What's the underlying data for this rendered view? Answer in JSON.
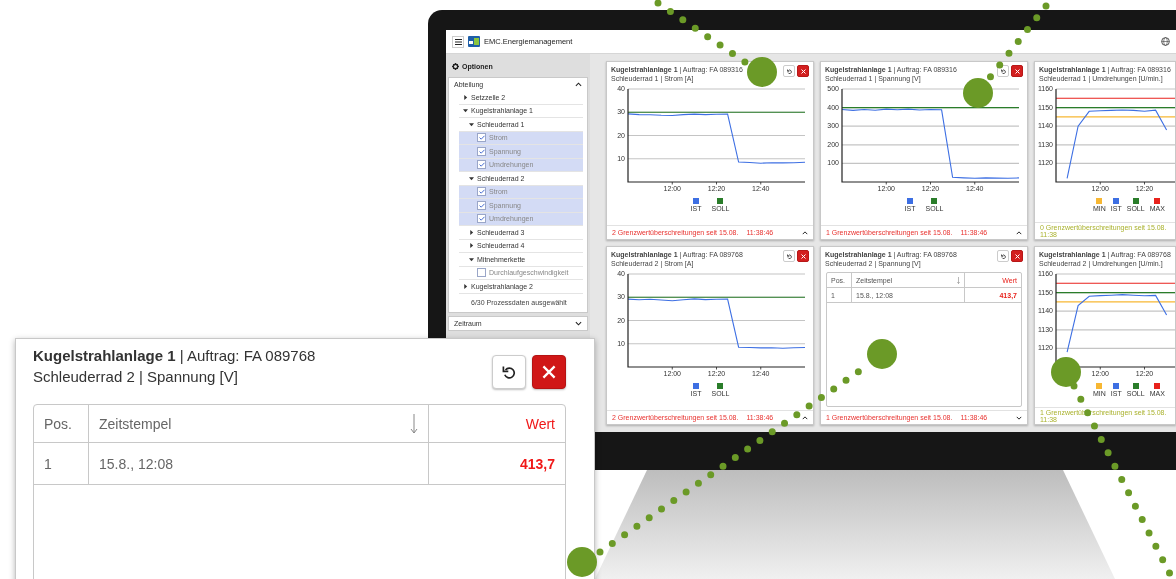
{
  "app": {
    "title": "EMC.Energiemanagement"
  },
  "sidebar": {
    "header": "Optionen",
    "sections": [
      {
        "title": "Abteilung",
        "expanded": true,
        "summary": "6/30 Prozessdaten ausgewählt",
        "tree": [
          {
            "kind": "group",
            "label": "Setzzelle 2",
            "expanded": false
          },
          {
            "kind": "group",
            "label": "Kugelstrahlanlage 1",
            "expanded": true,
            "children": [
              {
                "kind": "group",
                "label": "Schleuderrad 1",
                "expanded": true,
                "children": [
                  {
                    "kind": "check",
                    "label": "Strom",
                    "checked": true
                  },
                  {
                    "kind": "check",
                    "label": "Spannung",
                    "checked": true
                  },
                  {
                    "kind": "check",
                    "label": "Umdrehungen",
                    "checked": true
                  }
                ]
              },
              {
                "kind": "group",
                "label": "Schleuderrad 2",
                "expanded": true,
                "children": [
                  {
                    "kind": "check",
                    "label": "Strom",
                    "checked": true
                  },
                  {
                    "kind": "check",
                    "label": "Spannung",
                    "checked": true
                  },
                  {
                    "kind": "check",
                    "label": "Umdrehungen",
                    "checked": true
                  }
                ]
              },
              {
                "kind": "group",
                "label": "Schleuderrad 3",
                "expanded": false
              },
              {
                "kind": "group",
                "label": "Schleuderrad 4",
                "expanded": false
              },
              {
                "kind": "group",
                "label": "Mitnehmerkette",
                "expanded": true,
                "children": [
                  {
                    "kind": "check",
                    "label": "Durchlaufgeschwindigkeit",
                    "checked": false
                  }
                ]
              }
            ]
          },
          {
            "kind": "group",
            "label": "Kugelstrahlanlage 2",
            "expanded": false
          }
        ]
      },
      {
        "title": "Zeitraum",
        "expanded": false
      }
    ]
  },
  "cards": [
    {
      "kind": "chart",
      "title": "**Kugelstrahlanlage 1** | Auftrag: FA 089316",
      "subtitle": "Schleuderrad 1 | Strom [A]",
      "buttons_visible": true,
      "expanded": true,
      "footer": {
        "text": "2 Grenzwertüberschreitungen seit 15.08.",
        "time": "11:38:46",
        "kind": "alarm"
      },
      "chart_data": {
        "type": "line",
        "grid": true,
        "x": [
          700,
          705,
          710,
          715,
          720,
          725,
          730,
          735,
          740,
          745,
          750,
          755,
          760,
          765,
          770,
          775,
          780
        ],
        "xlim": [
          700,
          780
        ],
        "ylim": [
          0,
          40
        ],
        "yticks": [
          10,
          20,
          30,
          40
        ],
        "xticks": [
          {
            "value": 720,
            "label": "12:00"
          },
          {
            "value": 740,
            "label": "12:20"
          },
          {
            "value": 760,
            "label": "12:40"
          }
        ],
        "series": [
          {
            "name": "IST",
            "color": "#3d6fe3",
            "values": [
              29.3,
              29,
              28.9,
              28.7,
              28.6,
              29,
              29.2,
              29,
              29.1,
              29.2,
              8.6,
              8.4,
              8.1,
              8.3,
              8.2,
              8.3,
              8.5
            ]
          },
          {
            "name": "SOLL",
            "color": "#2a7d2a",
            "values": [
              30,
              30,
              30,
              30,
              30,
              30,
              30,
              30,
              30,
              30,
              30,
              30,
              30,
              30,
              30,
              30,
              30
            ]
          }
        ]
      }
    },
    {
      "kind": "chart",
      "title": "**Kugelstrahlanlage 1** | Auftrag: FA 089316",
      "subtitle": "Schleuderrad 1 | Spannung [V]",
      "buttons_visible": true,
      "expanded": true,
      "footer": {
        "text": "1 Grenzwertüberschreitungen seit 15.08.",
        "time": "11:38:46",
        "kind": "alarm"
      },
      "chart_data": {
        "type": "line",
        "grid": true,
        "x": [
          700,
          705,
          710,
          715,
          720,
          725,
          730,
          735,
          740,
          745,
          750,
          755,
          760,
          765,
          770,
          775,
          780
        ],
        "xlim": [
          700,
          780
        ],
        "ylim": [
          0,
          500
        ],
        "yticks": [
          100,
          200,
          300,
          400,
          500
        ],
        "xticks": [
          {
            "value": 720,
            "label": "12:00"
          },
          {
            "value": 740,
            "label": "12:20"
          },
          {
            "value": 760,
            "label": "12:40"
          }
        ],
        "series": [
          {
            "name": "IST",
            "color": "#3d6fe3",
            "values": [
              390,
              385,
              390,
              386,
              392,
              388,
              392,
              387,
              390,
              388,
              25,
              22,
              20,
              22,
              21,
              20,
              22
            ]
          },
          {
            "name": "SOLL",
            "color": "#2a7d2a",
            "values": [
              400,
              400,
              400,
              400,
              400,
              400,
              400,
              400,
              400,
              400,
              400,
              400,
              400,
              400,
              400,
              400,
              400
            ]
          }
        ]
      }
    },
    {
      "kind": "chart",
      "title": "**Kugelstrahlanlage 1** | Auftrag: FA 089316",
      "subtitle": "Schleuderrad 1 | Umdrehungen [U/min.]",
      "footer": {
        "text": "0 Grenzwertüberschreitungen seit 15.08.",
        "time": "11:38",
        "kind": "notice"
      },
      "chart_data": {
        "type": "line",
        "grid": true,
        "x": [
          700,
          705,
          710,
          715,
          720,
          725,
          730,
          735,
          740,
          745,
          750,
          755
        ],
        "xlim": [
          700,
          780
        ],
        "ylim": [
          1110,
          1160
        ],
        "yticks": [
          1120,
          1130,
          1140,
          1150,
          1160
        ],
        "xticks": [
          {
            "value": 720,
            "label": "12:00"
          },
          {
            "value": 740,
            "label": "12:20"
          }
        ],
        "series": [
          {
            "name": "MIN",
            "color": "#f7b733",
            "values": [
              1145,
              1145,
              1145,
              1145,
              1145,
              1145,
              1145,
              1145,
              1145,
              1145,
              1145,
              1145
            ]
          },
          {
            "name": "IST",
            "color": "#3d6fe3",
            "values": [
              null,
              1112,
              1140,
              1148,
              1148.3,
              1148.5,
              1148.7,
              1148.5,
              1148,
              1148.6,
              1138,
              null
            ]
          },
          {
            "name": "SOLL",
            "color": "#2a7d2a",
            "values": [
              1150,
              1150,
              1150,
              1150,
              1150,
              1150,
              1150,
              1150,
              1150,
              1150,
              1150,
              1150
            ]
          },
          {
            "name": "MAX",
            "color": "#e8221c",
            "values": [
              1155,
              1155,
              1155,
              1155,
              1155,
              1155,
              1155,
              1155,
              1155,
              1155,
              1155,
              1155
            ]
          }
        ]
      }
    },
    {
      "kind": "chart",
      "title": "**Kugelstrahlanlage 1** | Auftrag: FA 089768",
      "subtitle": "Schleuderrad 2 | Strom [A]",
      "buttons_visible": true,
      "expanded": true,
      "footer": {
        "text": "2 Grenzwertüberschreitungen seit 15.08.",
        "time": "11:38:46",
        "kind": "alarm"
      },
      "chart_data": {
        "type": "line",
        "grid": true,
        "x": [
          700,
          705,
          710,
          715,
          720,
          725,
          730,
          735,
          740,
          745,
          750,
          755,
          760,
          765,
          770,
          775,
          780
        ],
        "xlim": [
          700,
          780
        ],
        "ylim": [
          0,
          40
        ],
        "yticks": [
          10,
          20,
          30,
          40
        ],
        "xticks": [
          {
            "value": 720,
            "label": "12:00"
          },
          {
            "value": 740,
            "label": "12:20"
          },
          {
            "value": 760,
            "label": "12:40"
          }
        ],
        "series": [
          {
            "name": "IST",
            "color": "#3d6fe3",
            "values": [
              29.2,
              28.9,
              29.1,
              28.8,
              28.5,
              28.9,
              29.3,
              29,
              29.1,
              29.2,
              8.5,
              8.4,
              8.2,
              8.3,
              8.1,
              8.3,
              8.4
            ]
          },
          {
            "name": "SOLL",
            "color": "#2a7d2a",
            "values": [
              30,
              30,
              30,
              30,
              30,
              30,
              30,
              30,
              30,
              30,
              30,
              30,
              30,
              30,
              30,
              30,
              30
            ]
          }
        ]
      }
    },
    {
      "kind": "table",
      "title": "**Kugelstrahlanlage 1** | Auftrag: FA 089768",
      "subtitle": "Schleuderrad 2 | Spannung [V]",
      "buttons_visible": true,
      "expanded": false,
      "footer": {
        "text": "1 Grenzwertüberschreitungen seit 15.08.",
        "time": "11:38:46",
        "kind": "alarm"
      },
      "table": {
        "columns": [
          {
            "label": "Pos.",
            "kind": "pos",
            "sorted": false
          },
          {
            "label": "Zeitstempel",
            "kind": "text",
            "sorted": true
          },
          {
            "label": "Wert",
            "kind": "value",
            "sorted": false
          }
        ],
        "rows": [
          [
            "1",
            "15.8., 12:08",
            "413,7"
          ]
        ]
      }
    },
    {
      "kind": "chart",
      "title": "**Kugelstrahlanlage 1** | Auftrag: FA 089768",
      "subtitle": "Schleuderrad 2 | Umdrehungen [U/min.]",
      "footer": {
        "text": "1 Grenzwertüberschreitungen seit 15.08.",
        "time": "11:38",
        "kind": "notice"
      },
      "chart_data": {
        "type": "line",
        "grid": true,
        "x": [
          700,
          705,
          710,
          715,
          720,
          725,
          730,
          735,
          740,
          745,
          750,
          755
        ],
        "xlim": [
          700,
          780
        ],
        "ylim": [
          1110,
          1160
        ],
        "yticks": [
          1120,
          1130,
          1140,
          1150,
          1160
        ],
        "xticks": [
          {
            "value": 720,
            "label": "12:00"
          },
          {
            "value": 740,
            "label": "12:20"
          }
        ],
        "series": [
          {
            "name": "MIN",
            "color": "#f7b733",
            "values": [
              1145,
              1145,
              1145,
              1145,
              1145,
              1145,
              1145,
              1145,
              1145,
              1145,
              1145,
              1145
            ]
          },
          {
            "name": "IST",
            "color": "#3d6fe3",
            "values": [
              null,
              1118,
              1143,
              1148,
              1148.4,
              1148.6,
              1148.9,
              1148.6,
              1148.3,
              1148.5,
              1138,
              null
            ]
          },
          {
            "name": "SOLL",
            "color": "#2a7d2a",
            "values": [
              1150,
              1150,
              1150,
              1150,
              1150,
              1150,
              1150,
              1150,
              1150,
              1150,
              1150,
              1150
            ]
          },
          {
            "name": "MAX",
            "color": "#e8221c",
            "values": [
              1155,
              1155,
              1155,
              1155,
              1155,
              1155,
              1155,
              1155,
              1155,
              1155,
              1155,
              1155
            ]
          }
        ]
      }
    }
  ],
  "detail": {
    "title": "**Kugelstrahlanlage 1** | Auftrag: FA 089768",
    "subtitle": "Schleuderrad 2 | Spannung [V]",
    "table": {
      "columns": [
        {
          "label": "Pos.",
          "kind": "pos",
          "sorted": false
        },
        {
          "label": "Zeitstempel",
          "kind": "text",
          "sorted": true
        },
        {
          "label": "Wert",
          "kind": "value",
          "sorted": false
        }
      ],
      "rows": [
        [
          "1",
          "15.8., 12:08",
          "413,7"
        ]
      ]
    }
  }
}
